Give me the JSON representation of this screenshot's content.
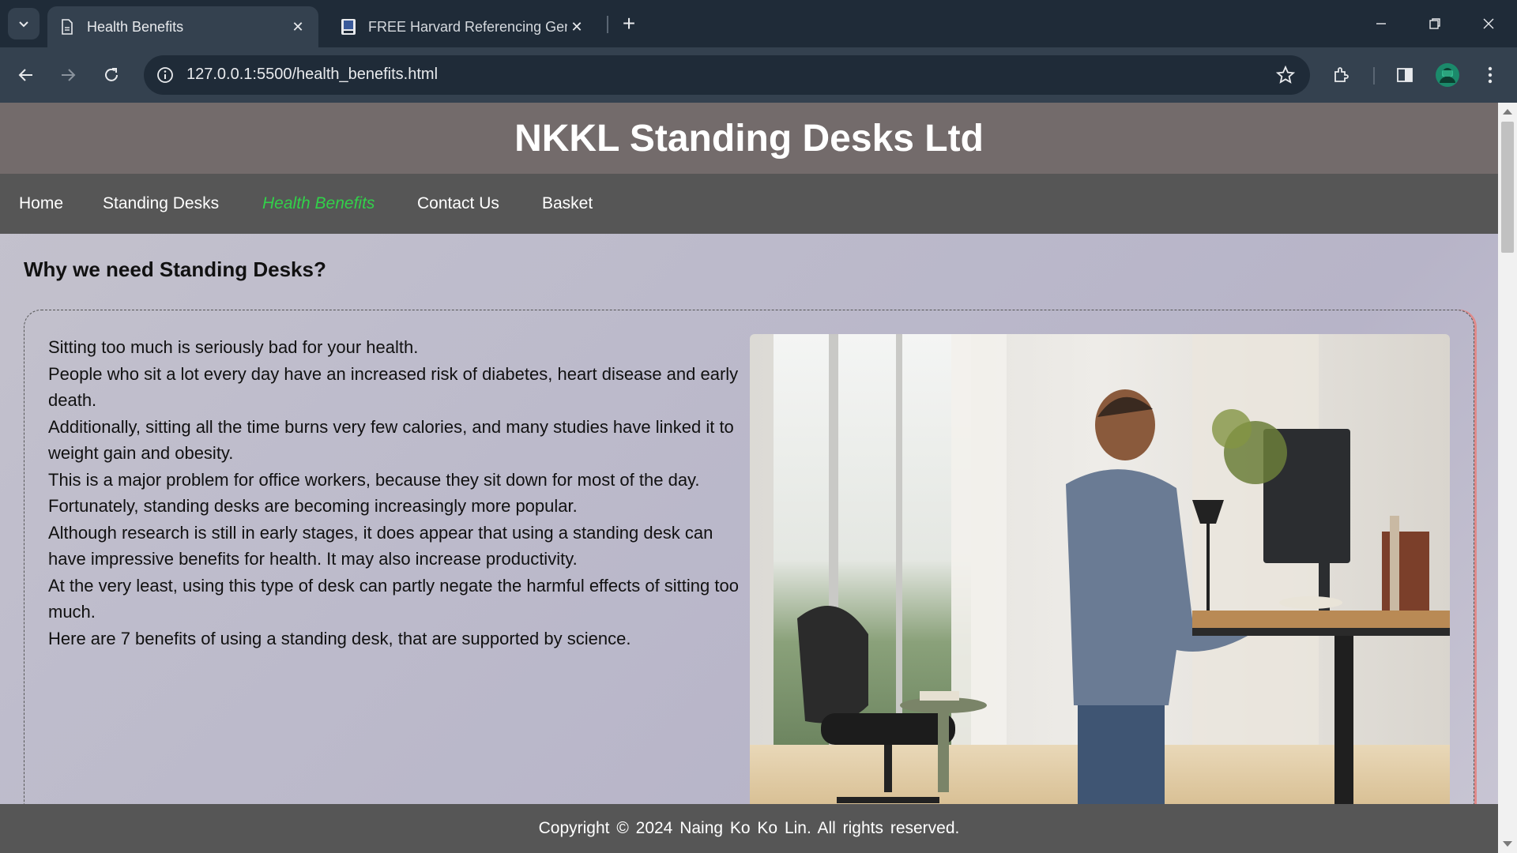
{
  "browser": {
    "tabs": [
      {
        "title": "Health Benefits",
        "active": true
      },
      {
        "title": "FREE Harvard Referencing Gene",
        "active": false
      }
    ],
    "url": "127.0.0.1:5500/health_benefits.html",
    "icons": [
      "tab-search-icon",
      "page-icon",
      "book-icon",
      "close-icon",
      "plus-icon",
      "minimize-icon",
      "restore-icon",
      "back-icon",
      "forward-icon",
      "reload-icon",
      "info-icon",
      "star-icon",
      "extensions-icon",
      "side-panel-icon",
      "profile-avatar",
      "kebab-menu-icon"
    ]
  },
  "site": {
    "title": "NKKL Standing Desks Ltd",
    "nav": [
      {
        "label": "Home",
        "active": false
      },
      {
        "label": "Standing Desks",
        "active": false
      },
      {
        "label": "Health Benefits",
        "active": true
      },
      {
        "label": "Contact Us",
        "active": false
      },
      {
        "label": "Basket",
        "active": false
      }
    ],
    "active_nav_color": "#32d14a",
    "header_color": "#736b6b",
    "nav_color": "#565656"
  },
  "main": {
    "heading": "Why we need Standing Desks?",
    "paragraphs": [
      "Sitting too much is seriously bad for your health.",
      "People who sit a lot every day have an increased risk of diabetes, heart disease and early death.",
      "Additionally, sitting all the time burns very few calories, and many studies have linked it to weight gain and obesity.",
      "This is a major problem for office workers, because they sit down for most of the day. Fortunately, standing desks are becoming increasingly more popular.",
      "Although research is still in early stages, it does appear that using a standing desk can have impressive benefits for health. It may also increase productivity.",
      "At the very least, using this type of desk can partly negate the harmful effects of sitting too much.",
      "Here are 7 benefits of using a standing desk, that are supported by science."
    ]
  },
  "footer": {
    "text": "Copyright © 2024 Naing Ko Ko Lin. All rights reserved."
  }
}
